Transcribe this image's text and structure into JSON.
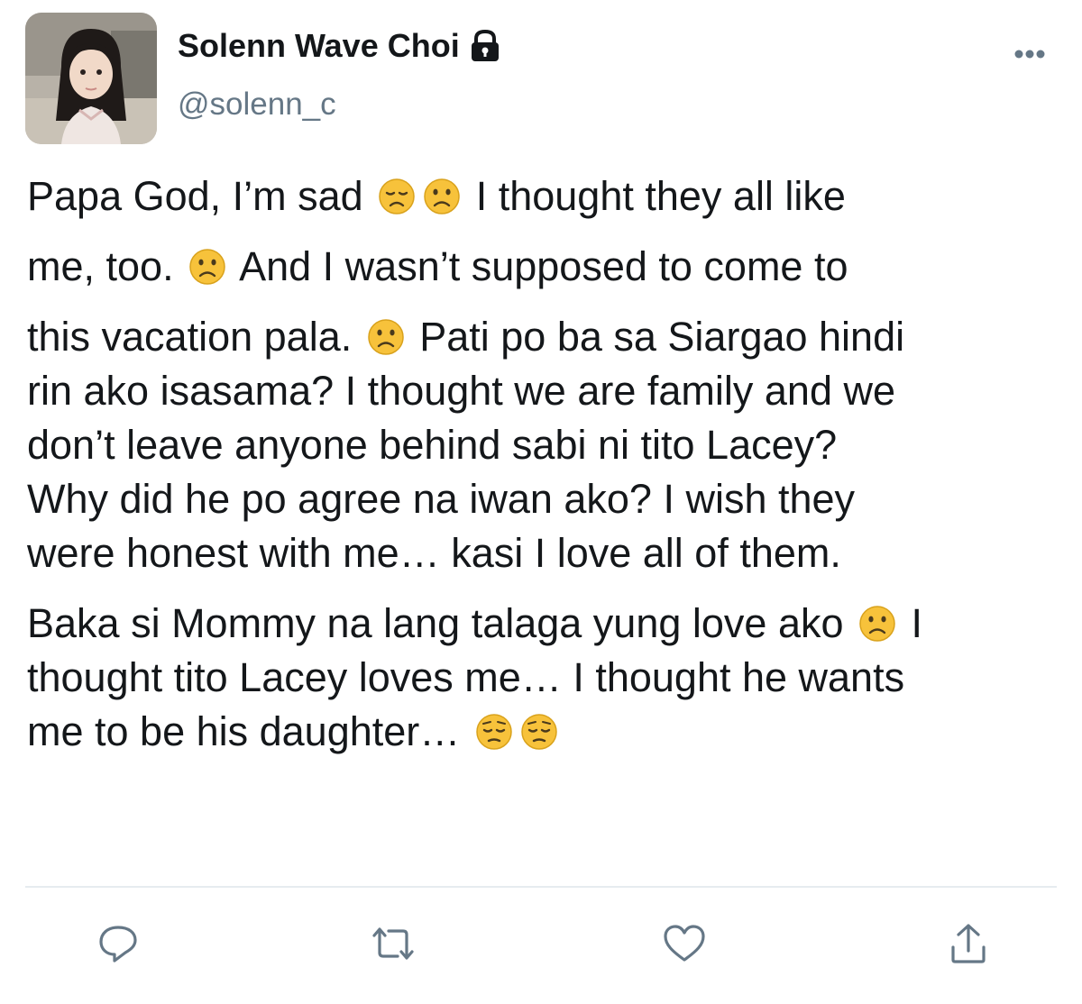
{
  "tweet": {
    "display_name": "Solenn Wave Choi",
    "handle": "@solenn_c",
    "protected_icon": "lock-icon",
    "more_icon": "ellipsis-icon",
    "avatar": "profile-photo",
    "lines": [
      [
        {
          "t": "Papa God, I’m sad "
        },
        {
          "e": "disappointed-face"
        },
        {
          "e": "frowning-face"
        },
        {
          "t": " I thought they all like"
        }
      ],
      [
        {
          "t": "me, too. "
        },
        {
          "e": "frowning-face"
        },
        {
          "t": " And I wasn’t supposed to come to"
        }
      ],
      [
        {
          "t": "this vacation pala. "
        },
        {
          "e": "frowning-face"
        },
        {
          "t": " Pati po ba sa Siargao hindi"
        }
      ],
      [
        {
          "t": "rin ako isasama? I thought we are family and we"
        }
      ],
      [
        {
          "t": "don’t leave anyone behind sabi ni tito Lacey?"
        }
      ],
      [
        {
          "t": "Why did he po agree na iwan ako? I wish they"
        }
      ],
      [
        {
          "t": "were honest with me… kasi I love all of them."
        }
      ],
      [
        {
          "t": "Baka si Mommy na lang talaga yung love ako "
        },
        {
          "e": "frowning-face"
        },
        {
          "t": " I"
        }
      ],
      [
        {
          "t": "thought tito Lacey loves me… I thought he wants"
        }
      ],
      [
        {
          "t": "me to be his daughter… "
        },
        {
          "e": "pensive-face"
        },
        {
          "e": "pensive-face"
        }
      ]
    ]
  },
  "actions": [
    {
      "name": "reply-button",
      "icon": "reply-icon"
    },
    {
      "name": "retweet-button",
      "icon": "retweet-icon"
    },
    {
      "name": "like-button",
      "icon": "heart-icon"
    },
    {
      "name": "share-button",
      "icon": "share-icon"
    }
  ],
  "colors": {
    "text": "#14171a",
    "secondary": "#657786",
    "icon": "#657786",
    "divider": "#e6ecf0",
    "emoji_face": "#f7c23b"
  }
}
